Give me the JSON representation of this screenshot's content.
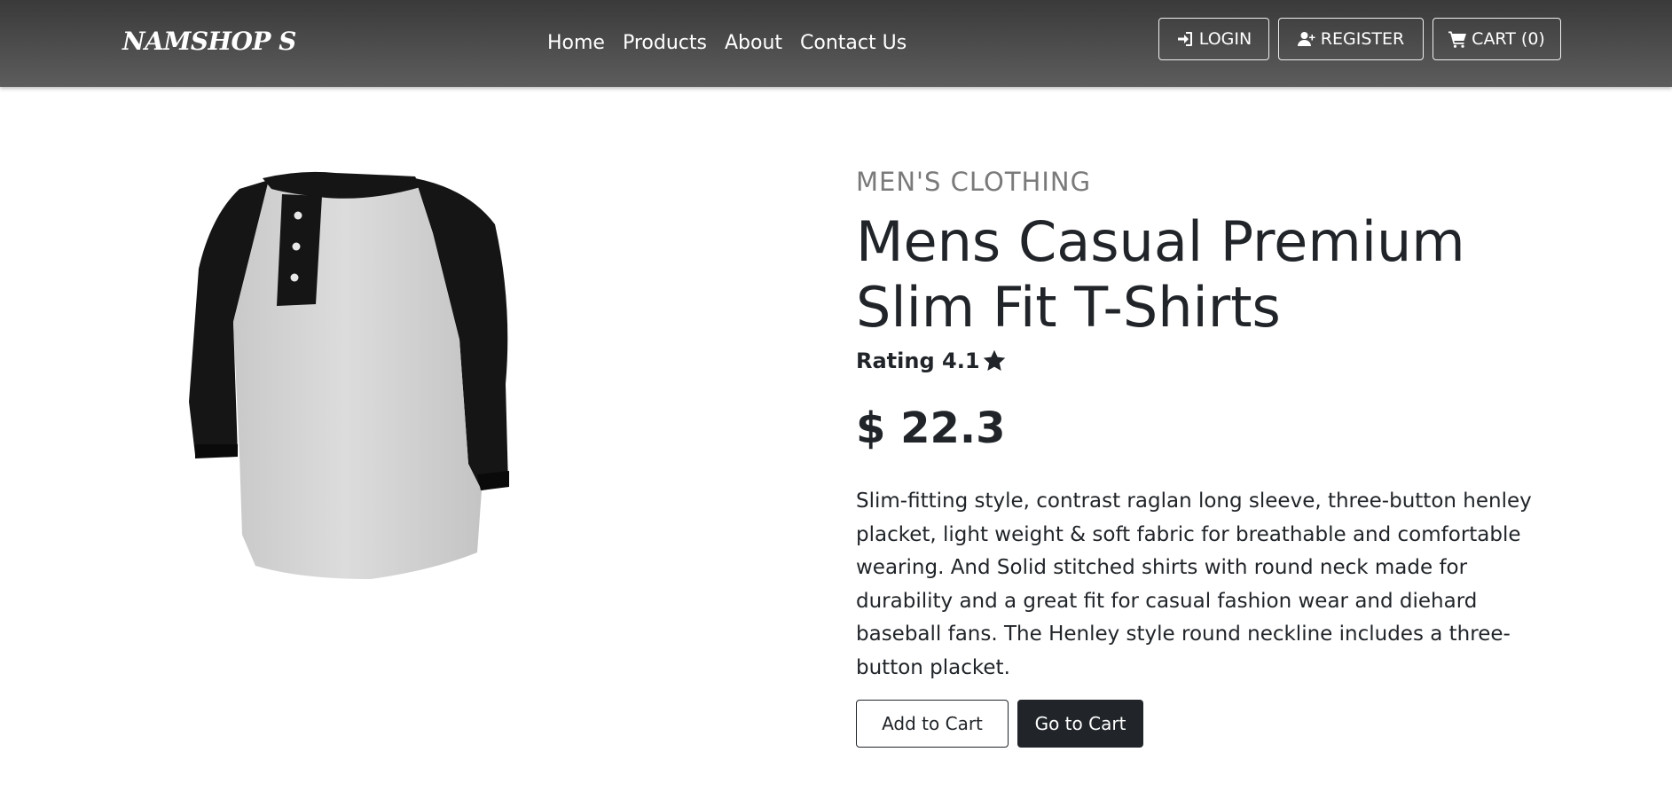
{
  "navbar": {
    "brand": "NAMSHOP S",
    "links": [
      "Home",
      "Products",
      "About",
      "Contact Us"
    ],
    "login_label": "LOGIN",
    "register_label": "REGISTER",
    "cart_label": "CART (0)"
  },
  "product": {
    "category": "MEN'S CLOTHING",
    "title": "Mens Casual Premium Slim Fit T-Shirts",
    "rating_label": "Rating 4.1",
    "price": "$ 22.3",
    "description": "Slim-fitting style, contrast raglan long sleeve, three-button henley placket, light weight & soft fabric for breathable and comfortable wearing. And Solid stitched shirts with round neck made for durability and a great fit for casual fashion wear and diehard baseball fans. The Henley style round neckline includes a three-button placket.",
    "add_to_cart_label": "Add to Cart",
    "go_to_cart_label": "Go to Cart"
  },
  "icons": {
    "login": "sign-in-icon",
    "register": "user-plus-icon",
    "cart": "shopping-cart-icon",
    "rating": "star-icon"
  }
}
